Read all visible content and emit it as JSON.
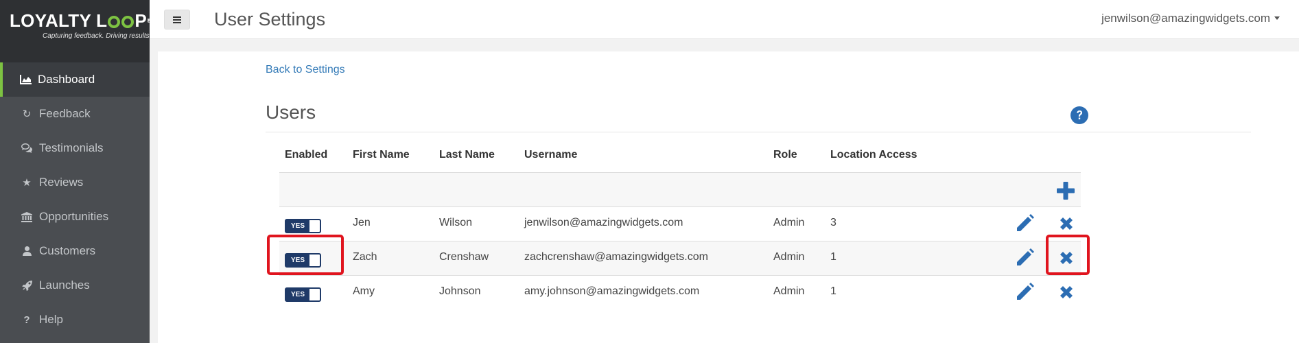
{
  "brand": {
    "name_part1": "LOYALTY L",
    "name_part2": "P",
    "mark": "®",
    "tagline": "Capturing feedback. Driving results."
  },
  "sidebar": {
    "items": [
      {
        "label": "Dashboard",
        "icon": "area-chart-icon",
        "active": true
      },
      {
        "label": "Feedback",
        "icon": "refresh-icon"
      },
      {
        "label": "Testimonials",
        "icon": "comments-icon"
      },
      {
        "label": "Reviews",
        "icon": "star-icon"
      },
      {
        "label": "Opportunities",
        "icon": "bank-icon"
      },
      {
        "label": "Customers",
        "icon": "user-icon"
      },
      {
        "label": "Launches",
        "icon": "rocket-icon"
      },
      {
        "label": "Help",
        "icon": "question-icon"
      }
    ]
  },
  "header": {
    "title": "User Settings",
    "user_email": "jenwilson@amazingwidgets.com"
  },
  "main": {
    "back_link": "Back to Settings",
    "section_title": "Users",
    "columns": [
      "Enabled",
      "First Name",
      "Last Name",
      "Username",
      "Role",
      "Location Access"
    ],
    "users": [
      {
        "enabled": "YES",
        "first_name": "Jen",
        "last_name": "Wilson",
        "username": "jenwilson@amazingwidgets.com",
        "role": "Admin",
        "location_access": "3"
      },
      {
        "enabled": "YES",
        "first_name": "Zach",
        "last_name": "Crenshaw",
        "username": "zachcrenshaw@amazingwidgets.com",
        "role": "Admin",
        "location_access": "1"
      },
      {
        "enabled": "YES",
        "first_name": "Amy",
        "last_name": "Johnson",
        "username": "amy.johnson@amazingwidgets.com",
        "role": "Admin",
        "location_access": "1"
      }
    ]
  },
  "colors": {
    "accent_green": "#7dc242",
    "link_blue": "#337ab7",
    "toggle_navy": "#1f3a68",
    "highlight_red": "#e0141e",
    "sidebar_bg": "#4a4d51"
  }
}
